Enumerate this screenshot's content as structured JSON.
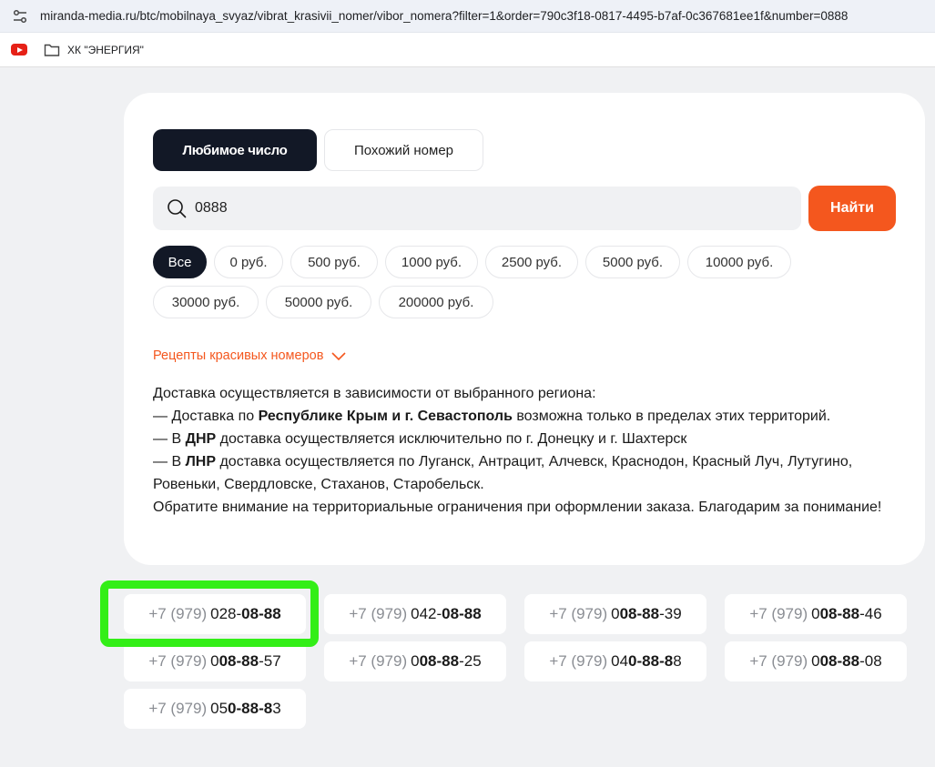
{
  "browser": {
    "url": "miranda-media.ru/btc/mobilnaya_svyaz/vibrat_krasivii_nomer/vibor_nomera?filter=1&order=790c3f18-0817-4495-b7af-0c367681ee1f&number=0888",
    "bookmark_folder": "ХК \"ЭНЕРГИЯ\""
  },
  "tabs": [
    {
      "label": "Любимое число",
      "active": true
    },
    {
      "label": "Похожий номер",
      "active": false
    }
  ],
  "search": {
    "value": "0888",
    "placeholder": "",
    "button": "Найти"
  },
  "price_filters": [
    "Все",
    "0 руб.",
    "500 руб.",
    "1000 руб.",
    "2500 руб.",
    "5000 руб.",
    "10000 руб.",
    "30000 руб.",
    "50000 руб.",
    "200000 руб."
  ],
  "recipes_link": "Рецепты красивых номеров",
  "delivery": {
    "intro": "Доставка осуществляется в зависимости от выбранного региона:",
    "line1_pre": "— Доставка по ",
    "line1_bold": "Республике Крым и г. Севастополь",
    "line1_post": " возможна только в пределах этих территорий.",
    "line2_pre": "— В ",
    "line2_bold": "ДНР",
    "line2_post": " доставка осуществляется исключительно по г. Донецку и г. Шахтерск",
    "line3_pre": "— В ",
    "line3_bold": "ЛНР",
    "line3_post": " доставка осуществляется по Луганск, Антрацит, Алчевск, Краснодон, Красный Луч, Лутугино, Ровеньки, Свердловске, Стаханов, Старобельск.",
    "notice": "Обратите внимание на территориальные ограничения при оформлении заказа. Благодарим за понимание!"
  },
  "numbers": [
    {
      "prefix": "+7 (979)",
      "parts": [
        [
          "0",
          false
        ],
        [
          "28-",
          false
        ],
        [
          "08-88",
          true
        ]
      ]
    },
    {
      "prefix": "+7 (979)",
      "parts": [
        [
          "042-",
          false
        ],
        [
          "08-88",
          true
        ]
      ]
    },
    {
      "prefix": "+7 (979)",
      "parts": [
        [
          "0",
          false
        ],
        [
          "08-88",
          true
        ],
        [
          "-39",
          false
        ]
      ]
    },
    {
      "prefix": "+7 (979)",
      "parts": [
        [
          "0",
          false
        ],
        [
          "08-88",
          true
        ],
        [
          "-46",
          false
        ]
      ]
    },
    {
      "prefix": "+7 (979)",
      "parts": [
        [
          "0",
          false
        ],
        [
          "08-88",
          true
        ],
        [
          "-57",
          false
        ]
      ]
    },
    {
      "prefix": "+7 (979)",
      "parts": [
        [
          "0",
          false
        ],
        [
          "08-88",
          true
        ],
        [
          "-25",
          false
        ]
      ]
    },
    {
      "prefix": "+7 (979)",
      "parts": [
        [
          "04",
          false
        ],
        [
          "0-88-8",
          true
        ],
        [
          "8",
          false
        ]
      ]
    },
    {
      "prefix": "+7 (979)",
      "parts": [
        [
          "0",
          false
        ],
        [
          "08-88",
          true
        ],
        [
          "-08",
          false
        ]
      ]
    },
    {
      "prefix": "+7 (979)",
      "parts": [
        [
          "05",
          false
        ],
        [
          "0-88-8",
          true
        ],
        [
          "3",
          false
        ]
      ]
    }
  ]
}
